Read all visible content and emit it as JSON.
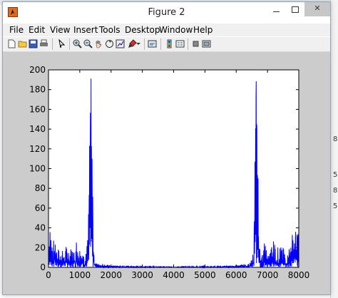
{
  "window": {
    "title": "Figure 2"
  },
  "menu": [
    "File",
    "Edit",
    "View",
    "Insert",
    "Tools",
    "Desktop",
    "Window",
    "Help"
  ],
  "toolbar": {
    "icons": [
      "new-figure-icon",
      "open-file-icon",
      "save-icon",
      "print-icon",
      "select-arrow-icon",
      "zoom-in-icon",
      "zoom-out-icon",
      "pan-icon",
      "rotate-3d-icon",
      "data-cursor-icon",
      "brush-icon",
      "link-plot-icon",
      "insert-colorbar-icon",
      "insert-legend-icon",
      "hide-plot-tools-icon",
      "show-plot-tools-icon"
    ]
  },
  "background_text": [
    "8",
    "5",
    "8",
    "5"
  ],
  "chart_data": {
    "type": "line",
    "series": [
      {
        "color": "#0000ff"
      }
    ],
    "x": [
      0,
      50,
      100,
      150,
      200,
      300,
      400,
      500,
      600,
      700,
      800,
      900,
      1000,
      1100,
      1150,
      1200,
      1250,
      1280,
      1300,
      1320,
      1340,
      1360,
      1380,
      1400,
      1420,
      1440,
      1460,
      1480,
      1500,
      1550,
      1600,
      1700,
      1800,
      2000,
      2500,
      3000,
      3500,
      4000,
      4500,
      5000,
      5500,
      6000,
      6200,
      6300,
      6400,
      6450,
      6500,
      6540,
      6560,
      6580,
      6600,
      6620,
      6640,
      6660,
      6680,
      6700,
      6720,
      6740,
      6760,
      6800,
      6850,
      6900,
      7000,
      7100,
      7200,
      7300,
      7400,
      7500,
      7600,
      7700,
      7800,
      7900,
      8000
    ],
    "y": [
      45,
      40,
      30,
      25,
      35,
      20,
      15,
      20,
      22,
      18,
      20,
      30,
      25,
      15,
      10,
      15,
      30,
      60,
      100,
      150,
      185,
      196,
      170,
      120,
      60,
      25,
      15,
      10,
      8,
      5,
      4,
      4,
      3,
      2,
      1.5,
      1,
      1,
      0.5,
      1,
      1,
      1.5,
      2,
      3,
      4,
      4,
      5,
      8,
      15,
      25,
      60,
      120,
      170,
      196,
      185,
      150,
      100,
      60,
      30,
      15,
      10,
      15,
      25,
      15,
      18,
      30,
      20,
      22,
      20,
      15,
      20,
      35,
      45,
      40
    ],
    "xlim": [
      0,
      8000
    ],
    "ylim": [
      0,
      200
    ],
    "xticks": [
      "0",
      "1000",
      "2000",
      "3000",
      "4000",
      "5000",
      "6000",
      "7000",
      "8000"
    ],
    "yticks": [
      "0",
      "20",
      "40",
      "60",
      "80",
      "100",
      "120",
      "140",
      "160",
      "180",
      "200"
    ],
    "title": "",
    "xlabel": "",
    "ylabel": "",
    "grid": false
  }
}
